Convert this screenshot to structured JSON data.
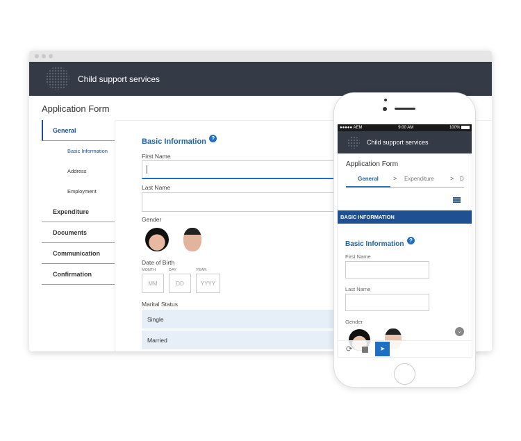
{
  "app": {
    "title": "Child support services",
    "form_title": "Application Form"
  },
  "sidebar": {
    "items": [
      {
        "label": "General",
        "active": true,
        "sub": [
          {
            "label": "Basic Information",
            "active": true
          },
          {
            "label": "Address"
          },
          {
            "label": "Employment"
          }
        ]
      },
      {
        "label": "Expenditure"
      },
      {
        "label": "Documents"
      },
      {
        "label": "Communication"
      },
      {
        "label": "Confirmation"
      }
    ]
  },
  "form": {
    "section_title": "Basic Information",
    "help_icon": "question-circle-icon",
    "first_name_label": "First Name",
    "first_name_value": "",
    "last_name_label": "Last Name",
    "last_name_value": "",
    "gender_label": "Gender",
    "dob_label": "Date of Birth",
    "dob": {
      "month_label": "MONTH",
      "day_label": "DAY",
      "year_label": "YEAR",
      "month_ph": "MM",
      "day_ph": "DD",
      "year_ph": "YYYY"
    },
    "marital_label": "Marital Status",
    "marital_options": [
      "Single",
      "Married"
    ]
  },
  "phone": {
    "carrier": "●●●●● AEM",
    "time": "9:00 AM",
    "battery": "100%",
    "tabs": [
      "General",
      "Expenditure",
      "D"
    ],
    "panel_header": "BASIC INFORMATION",
    "toolbar_icons": [
      "refresh-icon",
      "save-icon",
      "submit-icon"
    ]
  },
  "colors": {
    "header": "#343a46",
    "accent": "#1e63b0",
    "panel": "#1f5092",
    "option_bg": "#e6eef7"
  }
}
